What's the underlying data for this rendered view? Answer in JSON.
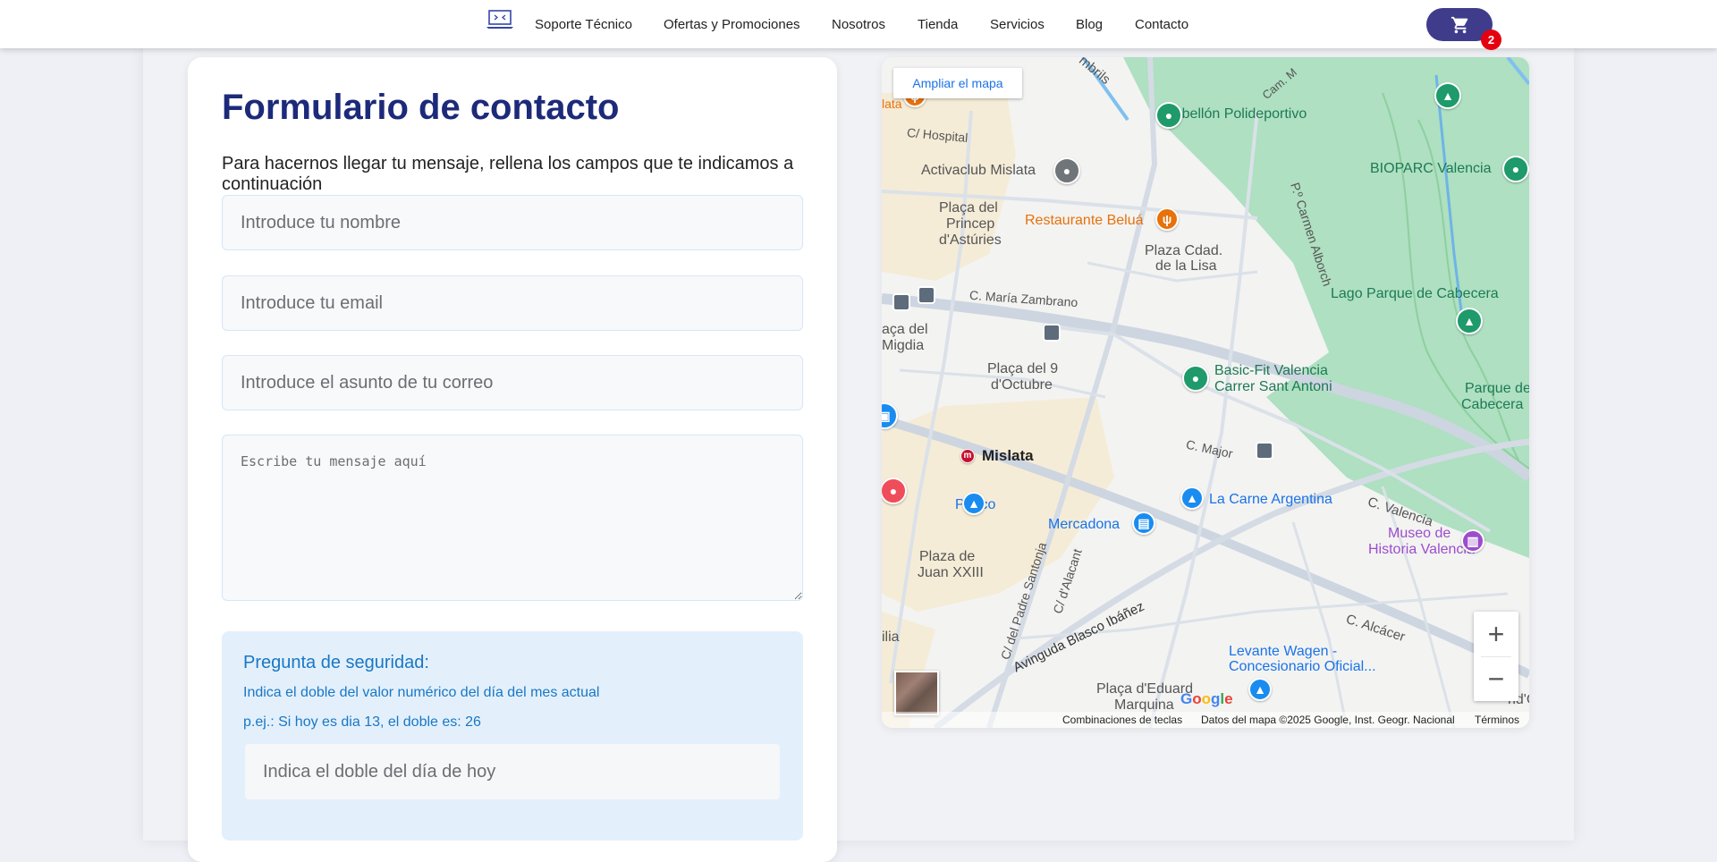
{
  "nav": {
    "links": [
      "Soporte Técnico",
      "Ofertas y Promociones",
      "Nosotros",
      "Tienda",
      "Servicios",
      "Blog",
      "Contacto"
    ],
    "cart_count": "2"
  },
  "form": {
    "title": "Formulario de contacto",
    "intro": "Para hacernos llegar tu mensaje, rellena los campos que te indicamos a continuación",
    "name_placeholder": "Introduce tu nombre",
    "email_placeholder": "Introduce tu email",
    "subject_placeholder": "Introduce el asunto de tu correo",
    "message_placeholder": "Escribe tu mensaje aquí",
    "security": {
      "title": "Pregunta de seguridad:",
      "question": "Indica el doble del valor numérico del día del mes actual",
      "example": "p.ej.: Si hoy es dia 13, el doble es: 26",
      "answer_placeholder": "Indica el doble del día de hoy"
    }
  },
  "map": {
    "expand_label": "Ampliar el mapa",
    "zoom_in": "+",
    "zoom_out": "−",
    "logo": "Google",
    "attribution": {
      "shortcuts": "Combinaciones de teclas",
      "data": "Datos del mapa ©2025 Google, Inst. Geogr. Nacional",
      "terms": "Términos"
    },
    "labels": {
      "pabellon": "Pabellón Polideportivo",
      "bioparc": "BIOPARC Valencia",
      "activaclub": "Activaclub Mislata",
      "restaurante": "Restaurante Beluá",
      "placa_princep_1": "Plaça del",
      "placa_princep_2": "Princep",
      "placa_princep_3": "d'Astúries",
      "plaza_lisa_1": "Plaza Cdad.",
      "plaza_lisa_2": "de la Lisa",
      "lago": "Lago Parque de Cabecera",
      "maria_zambrano": "C. María Zambrano",
      "hospital": "C/ Hospital",
      "carmen_alborch": "P.º Carmen Alborch",
      "cam": "Cam. M",
      "ambrils": "mbrils",
      "lata": "lata",
      "migdia_1": "aça del",
      "migdia_2": "Migdia",
      "placa_9_1": "Plaça del 9",
      "placa_9_2": "d'Octubre",
      "basicfit_1": "Basic-Fit Valencia",
      "basicfit_2": "Carrer Sant Antoni",
      "parque_cab_1": "Parque de",
      "parque_cab_2": "Cabecera",
      "c_major": "C. Major",
      "mislata": "Mislata",
      "pepco": "Pepco",
      "carne": "La Carne Argentina",
      "c_valencia": "C. Valencia",
      "mercadona": "Mercadona",
      "museo_1": "Museo de",
      "museo_2": "Historia Valencia",
      "juan_1": "Plaza de",
      "juan_2": "Juan XXIII",
      "santonja": "C/ del Padre Santonja",
      "alacant": "C/ d'Alacant",
      "blasco": "Avinguda Blasco Ibáñez",
      "alcacer": "C. Alcácer",
      "levante_1": "Levante Wagen -",
      "levante_2": "Concesionario Oficial...",
      "eduard_1": "Plaça d'Eduard",
      "eduard_2": "Marquina",
      "ilia": "ilia",
      "nd": "nd'C"
    },
    "colors": {
      "park": "#aee0c1",
      "road": "#d4dbe4",
      "residential": "#f5ecd7",
      "green_pin": "#1e9a6b",
      "orange_pin": "#e8710a",
      "blue_pin": "#1a8cf0",
      "purple_pin": "#9c4dcc",
      "grey_pin": "#70757a"
    }
  },
  "colors": {
    "title": "#1d2a7a",
    "cart": "#3f3c8c",
    "badge": "#e4000f",
    "security_bg": "#e3f0fb",
    "security_text": "#1977c6"
  }
}
